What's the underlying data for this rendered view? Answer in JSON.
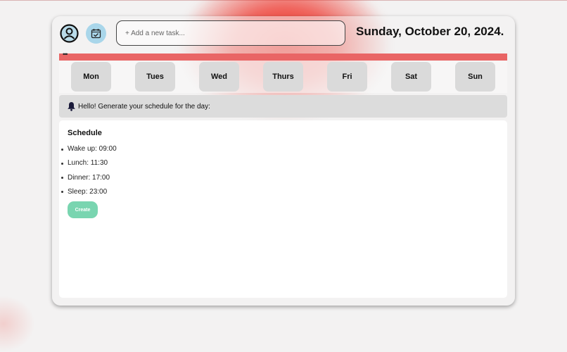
{
  "header": {
    "task_placeholder": "+ Add a new task...",
    "date": "Sunday, October 20, 2024."
  },
  "bar": {
    "indicator": "•••"
  },
  "days": [
    "Mon",
    "Tues",
    "Wed",
    "Thurs",
    "Fri",
    "Sat",
    "Sun"
  ],
  "notice": {
    "text": "Hello! Generate your schedule for the day:"
  },
  "schedule": {
    "title": "Schedule",
    "items": [
      "Wake up: 09:00",
      "Lunch: 11:30",
      "Dinner: 17:00",
      "Sleep: 23:00"
    ],
    "create_label": "Create"
  },
  "icons": {
    "profile": "user-circle-icon",
    "calendar": "calendar-check-icon",
    "bell": "bell-icon"
  },
  "colors": {
    "accent_bar": "#e96565",
    "calendar_button": "#a9d6ea",
    "create_button": "#79d5b0",
    "day_button": "#dadada"
  }
}
